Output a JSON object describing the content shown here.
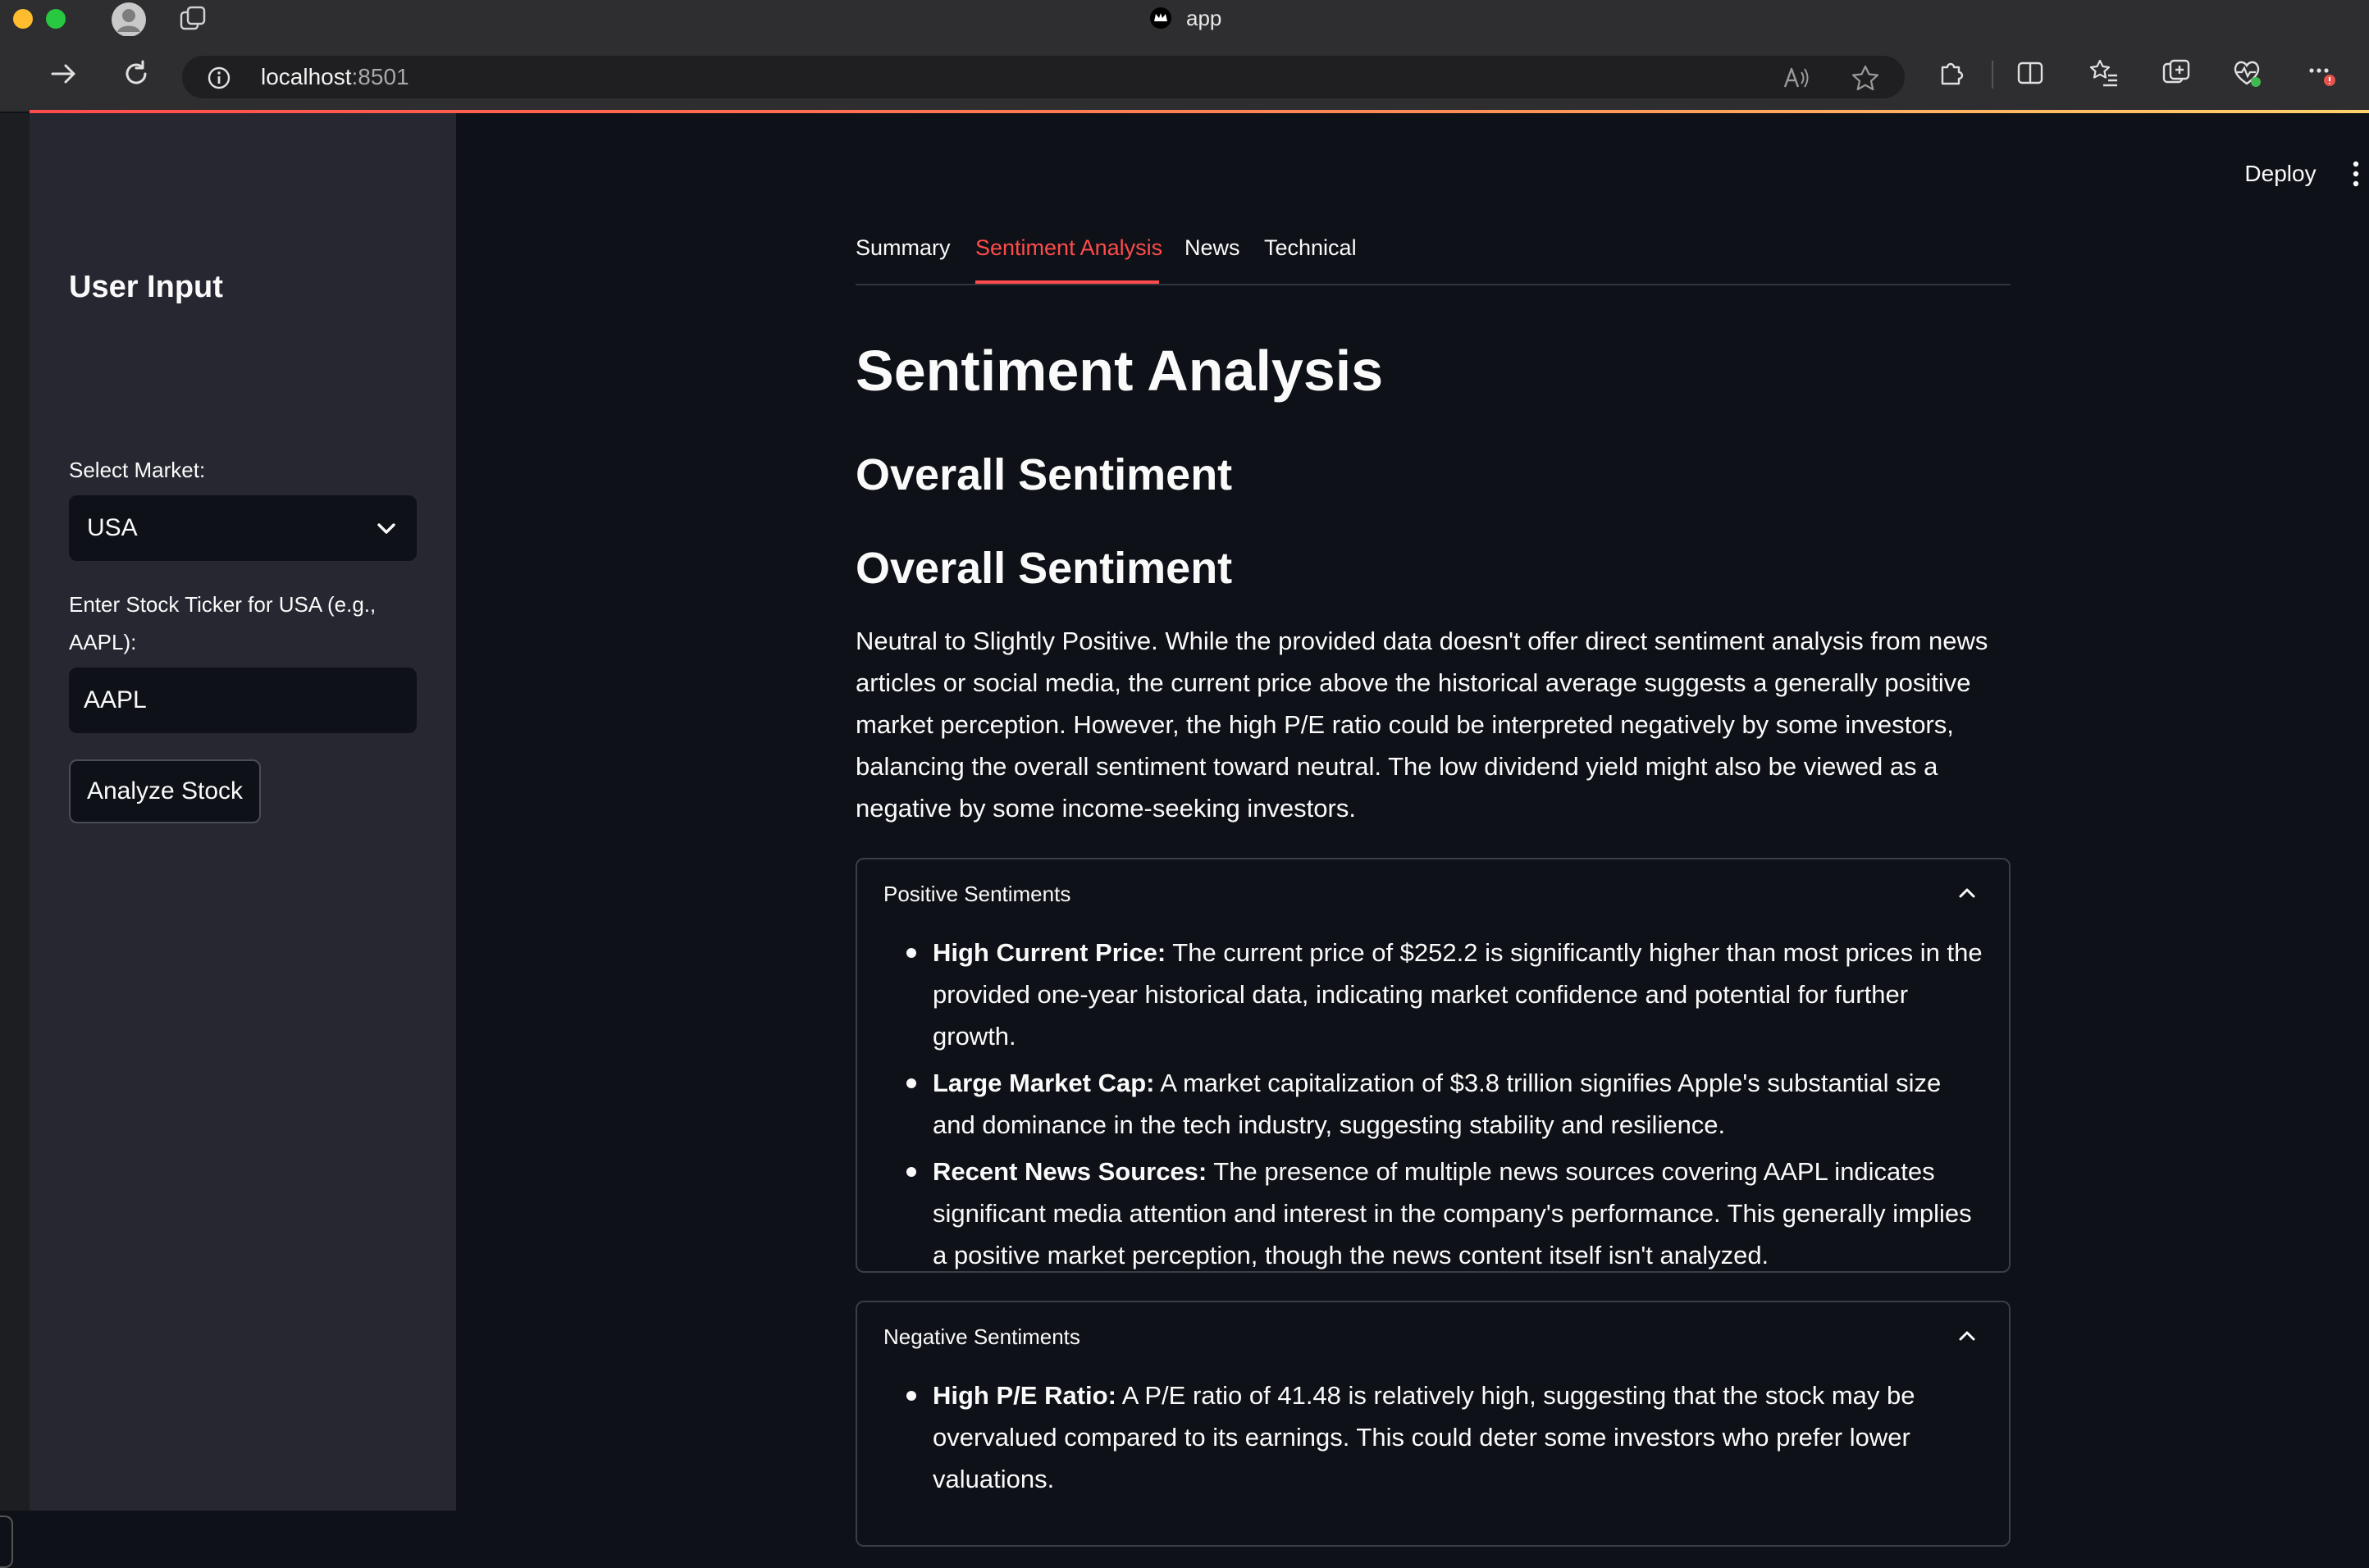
{
  "browser": {
    "window_title": "app",
    "url_host": "localhost",
    "url_port": ":8501"
  },
  "header": {
    "deploy_label": "Deploy"
  },
  "sidebar": {
    "heading": "User Input",
    "market_label": "Select Market:",
    "market_value": "USA",
    "ticker_label": "Enter Stock Ticker for USA (e.g., AAPL):",
    "ticker_value": "AAPL",
    "analyze_label": "Analyze Stock"
  },
  "tabs": [
    "Summary",
    "Sentiment Analysis",
    "News",
    "Technical"
  ],
  "active_tab": "Sentiment Analysis",
  "main": {
    "title": "Sentiment Analysis",
    "subheading_1": "Overall Sentiment",
    "subheading_2": "Overall Sentiment",
    "overall_text": "Neutral to Slightly Positive. While the provided data doesn't offer direct sentiment analysis from news articles or social media, the current price above the historical average suggests a generally positive market perception. However, the high P/E ratio could be interpreted negatively by some investors, balancing the overall sentiment toward neutral. The low dividend yield might also be viewed as a negative by some income-seeking investors.",
    "positive": {
      "summary": "Positive Sentiments",
      "items": [
        {
          "title": "High Current Price:",
          "text": " The current price of $252.2 is significantly higher than most prices in the provided one-year historical data, indicating market confidence and potential for further growth."
        },
        {
          "title": "Large Market Cap:",
          "text": " A market capitalization of $3.8 trillion signifies Apple's substantial size and dominance in the tech industry, suggesting stability and resilience."
        },
        {
          "title": "Recent News Sources:",
          "text": " The presence of multiple news sources covering AAPL indicates significant media attention and interest in the company's performance. This generally implies a positive market perception, though the news content itself isn't analyzed."
        }
      ]
    },
    "negative": {
      "summary": "Negative Sentiments",
      "items": [
        {
          "title": "High P/E Ratio:",
          "text": " A P/E ratio of 41.48 is relatively high, suggesting that the stock may be overvalued compared to its earnings. This could deter some investors who prefer lower valuations."
        }
      ]
    }
  },
  "colors": {
    "accent": "#ff4b4b",
    "background": "#0e1117",
    "sidebar": "#262730",
    "chrome": "#2e2e30"
  }
}
